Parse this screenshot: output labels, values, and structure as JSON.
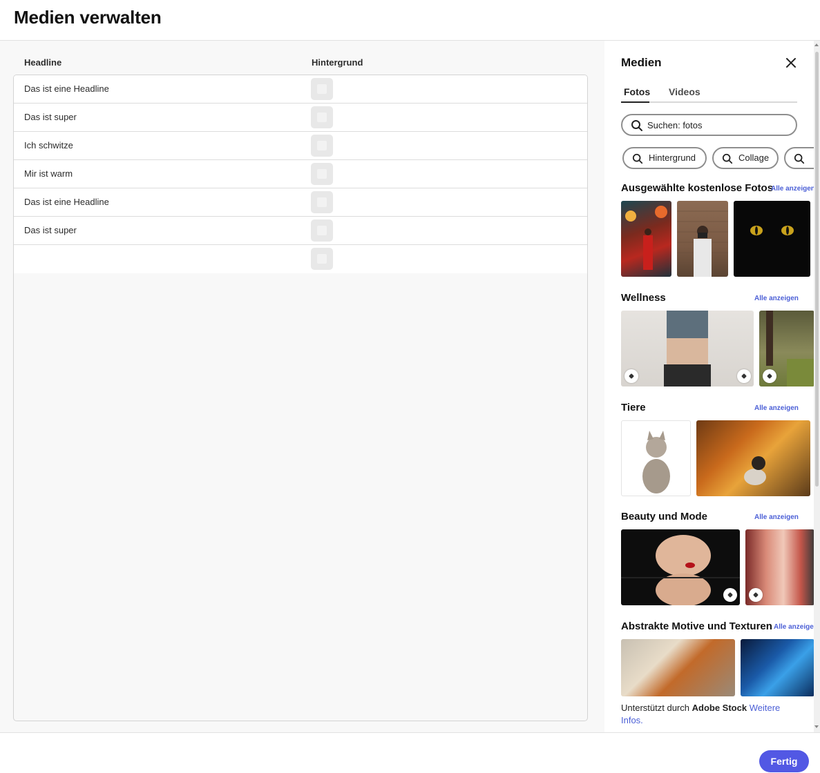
{
  "header": {
    "title": "Medien verwalten"
  },
  "table": {
    "columns": [
      "Headline",
      "Hintergrund"
    ],
    "rows": [
      {
        "headline": "Das ist eine Headline"
      },
      {
        "headline": "Das ist super"
      },
      {
        "headline": "Ich schwitze"
      },
      {
        "headline": "Mir ist warm"
      },
      {
        "headline": "Das ist eine Headline"
      },
      {
        "headline": "Das ist super"
      },
      {
        "headline": ""
      }
    ]
  },
  "panel": {
    "title": "Medien",
    "tabs": [
      {
        "label": "Fotos",
        "active": true
      },
      {
        "label": "Videos",
        "active": false
      }
    ],
    "search": {
      "value": "Suchen: fotos"
    },
    "chips": [
      "Hintergrund",
      "Collage",
      ""
    ],
    "see_all_label": "Alle anzeigen",
    "sections": [
      {
        "title": "Ausgewählte kostenlose Fotos"
      },
      {
        "title": "Wellness"
      },
      {
        "title": "Tiere"
      },
      {
        "title": "Beauty und Mode"
      },
      {
        "title": "Abstrakte Motive und Texturen"
      }
    ],
    "footer": {
      "prefix": "Unterstützt durch ",
      "brand": "Adobe Stock",
      "link": "Weitere Infos."
    }
  },
  "footer": {
    "done_label": "Fertig"
  },
  "colors": {
    "accent": "#5258e4",
    "link": "#4b5fd6"
  },
  "icons": {
    "close": "close-icon",
    "search": "search-icon",
    "image_placeholder": "image-placeholder-icon",
    "premium": "premium-badge-icon",
    "free": "free-badge-icon"
  }
}
